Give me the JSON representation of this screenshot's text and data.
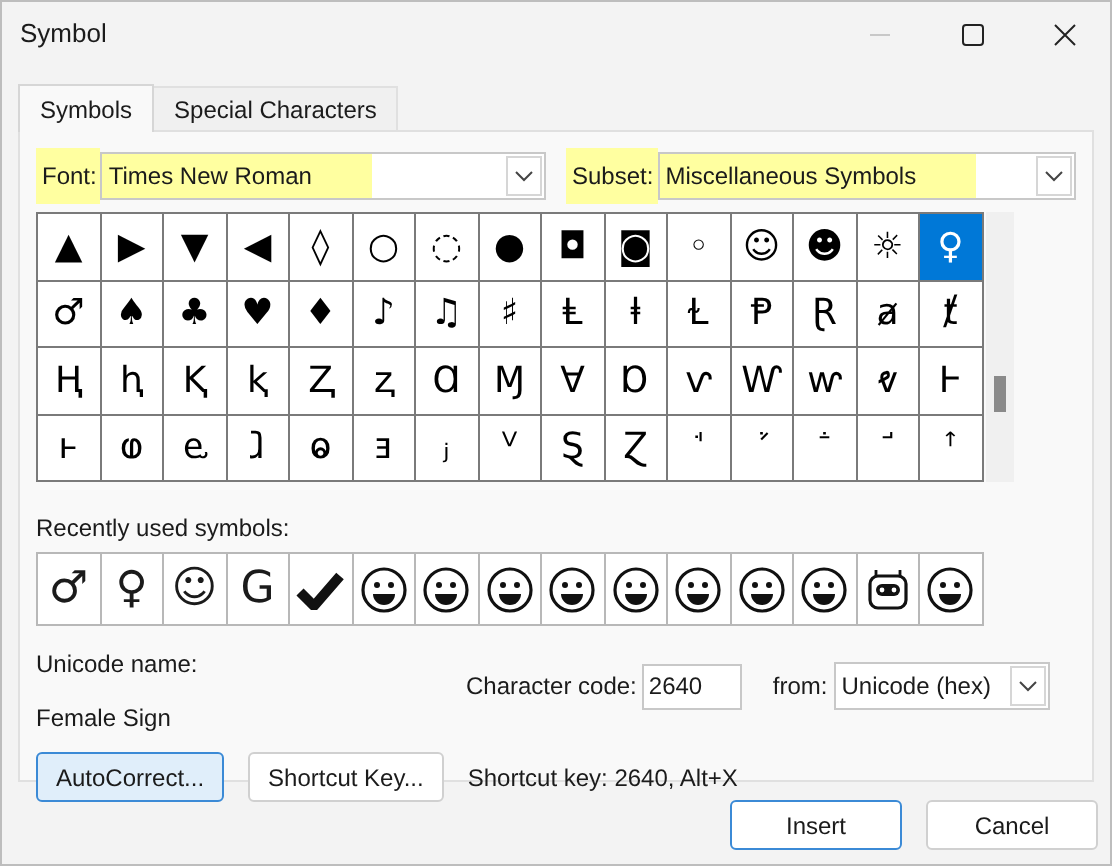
{
  "window": {
    "title": "Symbol"
  },
  "tabs": [
    {
      "label": "Symbols",
      "selected": true
    },
    {
      "label": "Special Characters",
      "selected": false
    }
  ],
  "font": {
    "label": "Font:",
    "value": "Times New Roman"
  },
  "subset": {
    "label": "Subset:",
    "value": "Miscellaneous Symbols"
  },
  "symbols": [
    {
      "char": "▲",
      "selected": false
    },
    {
      "char": "▶",
      "selected": false
    },
    {
      "char": "▼",
      "selected": false
    },
    {
      "char": "◀",
      "selected": false
    },
    {
      "char": "◊",
      "selected": false
    },
    {
      "char": "○",
      "selected": false
    },
    {
      "char": "◌",
      "selected": false
    },
    {
      "char": "●",
      "selected": false
    },
    {
      "char": "◘",
      "selected": false
    },
    {
      "char": "◙",
      "selected": false
    },
    {
      "char": "◦",
      "selected": false
    },
    {
      "char": "☺",
      "selected": false
    },
    {
      "char": "☻",
      "selected": false
    },
    {
      "char": "☼",
      "selected": false
    },
    {
      "char": "♀",
      "selected": true
    },
    {
      "char": "♂",
      "selected": false
    },
    {
      "char": "♠",
      "selected": false
    },
    {
      "char": "♣",
      "selected": false
    },
    {
      "char": "♥",
      "selected": false
    },
    {
      "char": "♦",
      "selected": false
    },
    {
      "char": "♪",
      "selected": false
    },
    {
      "char": "♫",
      "selected": false
    },
    {
      "char": "♯",
      "selected": false
    },
    {
      "char": "Ⱡ",
      "selected": false
    },
    {
      "char": "ⱡ",
      "selected": false
    },
    {
      "char": "Ɫ",
      "selected": false
    },
    {
      "char": "Ᵽ",
      "selected": false
    },
    {
      "char": "Ɽ",
      "selected": false
    },
    {
      "char": "ⱥ",
      "selected": false
    },
    {
      "char": "ⱦ",
      "selected": false
    },
    {
      "char": "Ⱨ",
      "selected": false
    },
    {
      "char": "ⱨ",
      "selected": false
    },
    {
      "char": "Ⱪ",
      "selected": false
    },
    {
      "char": "ⱪ",
      "selected": false
    },
    {
      "char": "Ⱬ",
      "selected": false
    },
    {
      "char": "ⱬ",
      "selected": false
    },
    {
      "char": "Ɑ",
      "selected": false
    },
    {
      "char": "Ɱ",
      "selected": false
    },
    {
      "char": "Ɐ",
      "selected": false
    },
    {
      "char": "Ɒ",
      "selected": false
    },
    {
      "char": "ⱱ",
      "selected": false
    },
    {
      "char": "Ⱳ",
      "selected": false
    },
    {
      "char": "ⱳ",
      "selected": false
    },
    {
      "char": "ⱴ",
      "selected": false
    },
    {
      "char": "Ⱶ",
      "selected": false
    },
    {
      "char": "ⱶ",
      "selected": false
    },
    {
      "char": "ⱷ",
      "selected": false
    },
    {
      "char": "ⱸ",
      "selected": false
    },
    {
      "char": "ⱹ",
      "selected": false
    },
    {
      "char": "ⱺ",
      "selected": false
    },
    {
      "char": "ⱻ",
      "selected": false
    },
    {
      "char": "ⱼ",
      "selected": false
    },
    {
      "char": "ⱽ",
      "selected": false
    },
    {
      "char": "Ȿ",
      "selected": false
    },
    {
      "char": "Ɀ",
      "selected": false
    },
    {
      "char": "ꜗ",
      "selected": false
    },
    {
      "char": "ꜘ",
      "selected": false
    },
    {
      "char": "ꜙ",
      "selected": false
    },
    {
      "char": "ꜚ",
      "selected": false
    },
    {
      "char": "ꜛ",
      "selected": false
    }
  ],
  "recent": {
    "label": "Recently used symbols:",
    "items": [
      {
        "kind": "char",
        "char": "♂"
      },
      {
        "kind": "char",
        "char": "♀"
      },
      {
        "kind": "char",
        "char": "☺"
      },
      {
        "kind": "char",
        "char": "G"
      },
      {
        "kind": "check"
      },
      {
        "kind": "emoji"
      },
      {
        "kind": "emoji"
      },
      {
        "kind": "emoji"
      },
      {
        "kind": "emoji"
      },
      {
        "kind": "emoji"
      },
      {
        "kind": "emoji"
      },
      {
        "kind": "emoji"
      },
      {
        "kind": "emoji"
      },
      {
        "kind": "robot"
      },
      {
        "kind": "emoji"
      }
    ]
  },
  "unicode_name": {
    "label": "Unicode name:",
    "value": "Female Sign"
  },
  "character_code": {
    "label": "Character code:",
    "value": "2640"
  },
  "from": {
    "label": "from:",
    "value": "Unicode (hex)"
  },
  "buttons": [
    {
      "label": "AutoCorrect...",
      "focused": true
    },
    {
      "label": "Shortcut Key...",
      "focused": false
    }
  ],
  "shortcut_text": "Shortcut key: 2640, Alt+X",
  "footer_buttons": [
    {
      "label": "Insert",
      "default": true
    },
    {
      "label": "Cancel",
      "default": false
    }
  ]
}
